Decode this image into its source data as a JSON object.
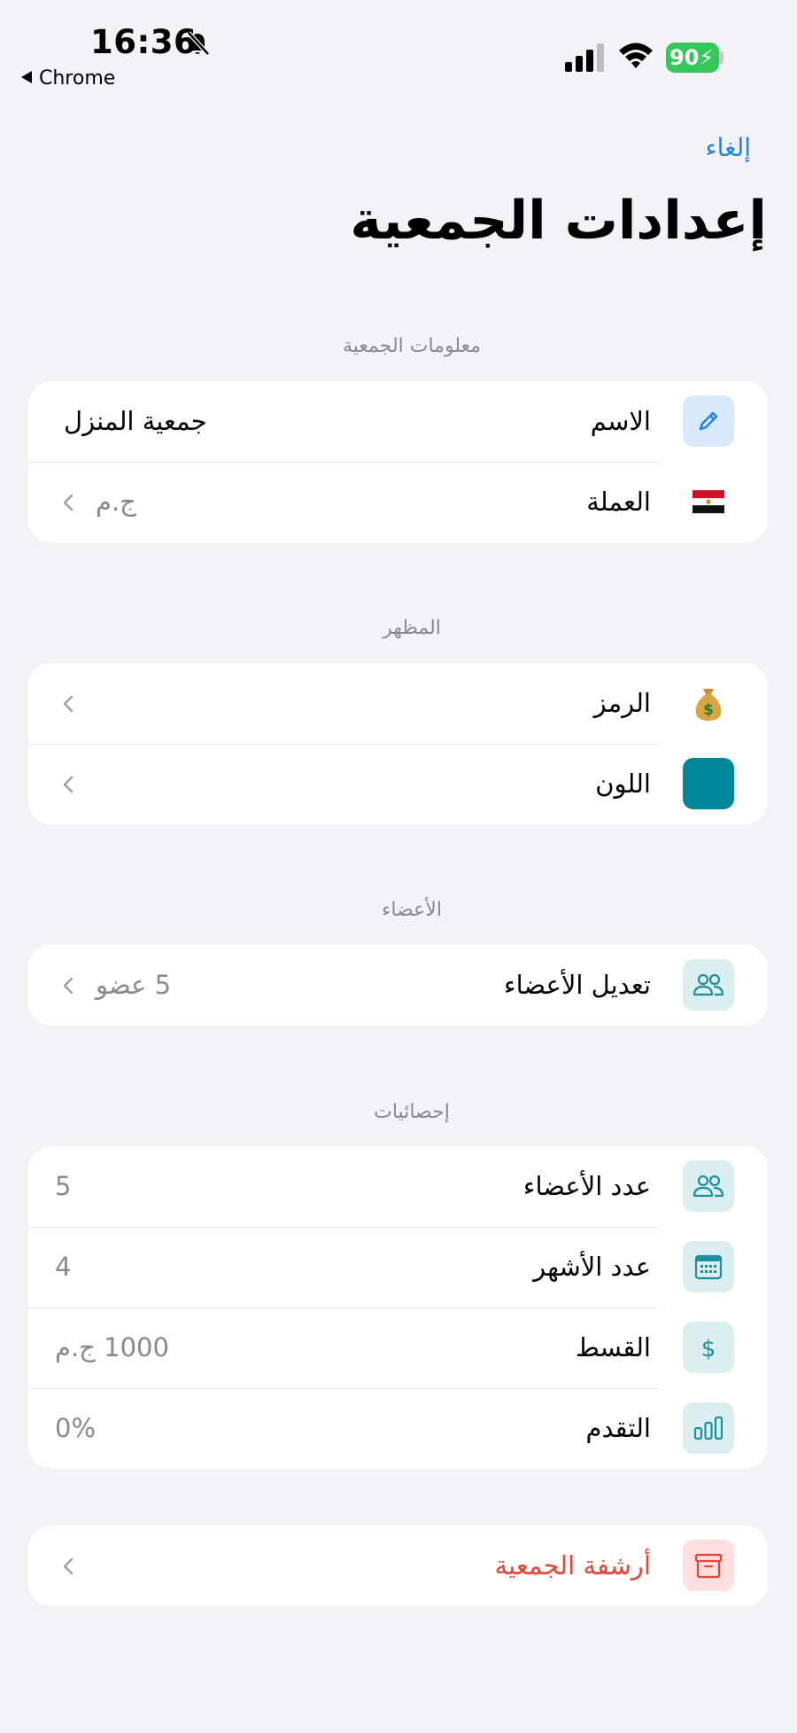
{
  "status_bar": {
    "time": "16:36",
    "back_app": "Chrome",
    "battery": "90"
  },
  "nav": {
    "cancel": "إلغاء",
    "title": "إعدادات الجمعية"
  },
  "colors": {
    "accent": "#1f86e0",
    "teal": "#00889a",
    "destructive": "#ea4335"
  },
  "sections": {
    "info": {
      "header": "معلومات الجمعية",
      "name_label": "الاسم",
      "name_value": "جمعية المنزل",
      "currency_label": "العملة",
      "currency_value": "ج.م",
      "currency_icon": "egypt-flag"
    },
    "appearance": {
      "header": "المظهر",
      "symbol_label": "الرمز",
      "symbol_icon": "money-bag",
      "color_label": "اللون",
      "color_value": "#00889a"
    },
    "members": {
      "header": "الأعضاء",
      "edit_label": "تعديل الأعضاء",
      "edit_value": "5 عضو"
    },
    "stats": {
      "header": "إحصائيات",
      "members_count_label": "عدد الأعضاء",
      "members_count_value": "5",
      "months_count_label": "عدد الأشهر",
      "months_count_value": "4",
      "installment_label": "القسط",
      "installment_value": "1000 ج.م",
      "progress_label": "التقدم",
      "progress_value": "0%"
    },
    "archive": {
      "label": "أرشفة الجمعية"
    }
  }
}
